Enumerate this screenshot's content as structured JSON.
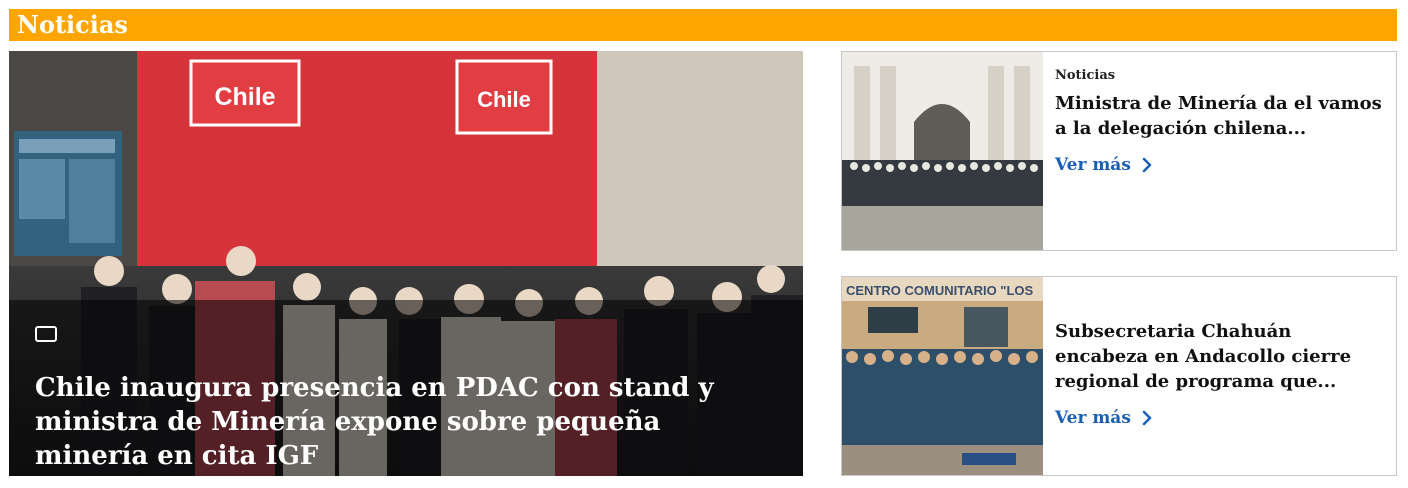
{
  "section": {
    "title": "Noticias"
  },
  "hero": {
    "title": "Chile inaugura presencia en PDAC con stand y ministra de Minería expone sobre pequeña minería en cita IGF",
    "image_brand_text": "Chile",
    "media_icon": "video-icon"
  },
  "cards": [
    {
      "category": "Noticias",
      "title": "Ministra de Minería da el vamos a la delegación chilena...",
      "link_label": "Ver más",
      "link_icon": "chevron-right-icon"
    },
    {
      "category": "",
      "title": "Subsecretaria Chahuán encabeza en Andacollo cierre regional de programa que...",
      "link_label": "Ver más",
      "link_icon": "chevron-right-icon",
      "image_sign_text": "CENTRO COMUNITARIO \"LOS"
    }
  ],
  "colors": {
    "header": "#ffa500",
    "link": "#1a5fb4"
  }
}
